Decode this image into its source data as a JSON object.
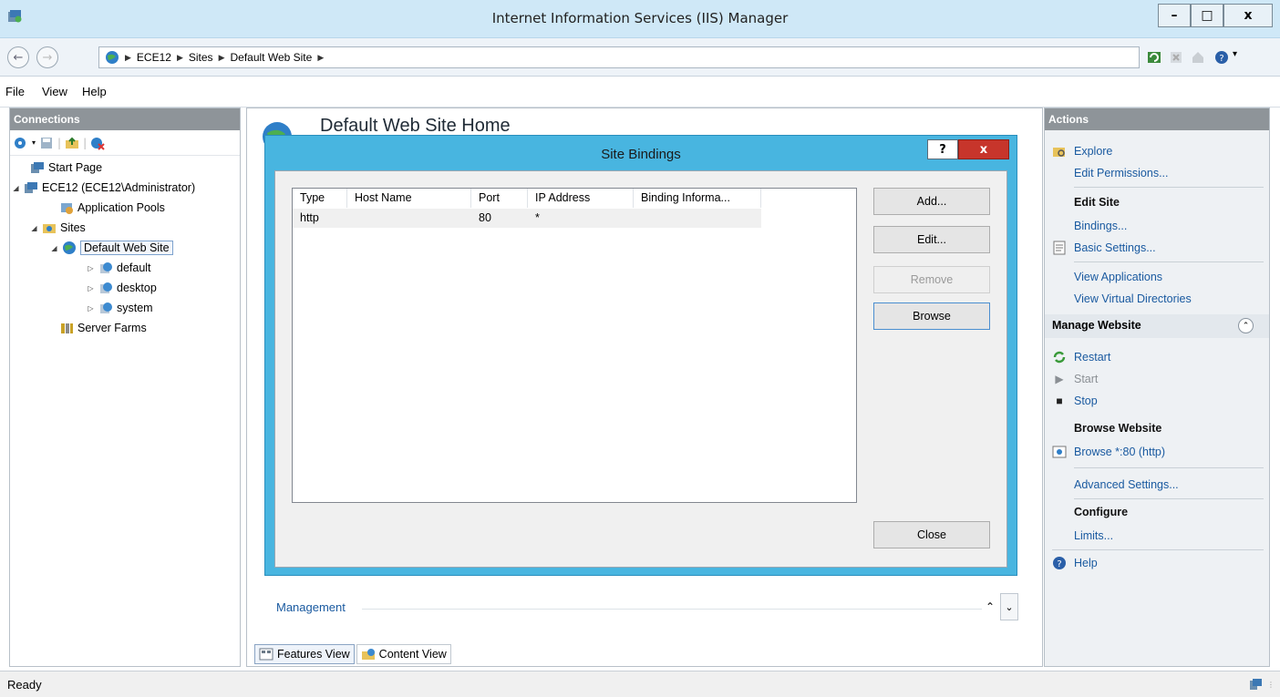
{
  "window": {
    "title": "Internet Information Services (IIS) Manager",
    "minimize": "–",
    "maximize": "□",
    "close": "x"
  },
  "address": {
    "crumbs": [
      "ECE12",
      "Sites",
      "Default Web Site"
    ]
  },
  "menu": {
    "file": "File",
    "view": "View",
    "help": "Help"
  },
  "connections": {
    "header": "Connections",
    "tree": {
      "start_page": "Start Page",
      "server": "ECE12 (ECE12\\Administrator)",
      "app_pools": "Application Pools",
      "sites": "Sites",
      "default_web_site": "Default Web Site",
      "child_default": "default",
      "child_desktop": "desktop",
      "child_system": "system",
      "server_farms": "Server Farms"
    }
  },
  "center": {
    "title": "Default Web Site Home",
    "management": "Management",
    "features_view": "Features View",
    "content_view": "Content View"
  },
  "dialog": {
    "title": "Site Bindings",
    "help": "?",
    "close_x": "x",
    "columns": [
      "Type",
      "Host Name",
      "Port",
      "IP Address",
      "Binding Informa..."
    ],
    "rows": [
      {
        "type": "http",
        "host": "",
        "port": "80",
        "ip": "*",
        "info": ""
      }
    ],
    "buttons": {
      "add": "Add...",
      "edit": "Edit...",
      "remove": "Remove",
      "browse": "Browse",
      "close": "Close"
    }
  },
  "actions": {
    "header": "Actions",
    "explore": "Explore",
    "edit_permissions": "Edit Permissions...",
    "edit_site": "Edit Site",
    "bindings": "Bindings...",
    "basic_settings": "Basic Settings...",
    "view_applications": "View Applications",
    "view_virtual_directories": "View Virtual Directories",
    "manage_website": "Manage Website",
    "restart": "Restart",
    "start": "Start",
    "stop": "Stop",
    "browse_website": "Browse Website",
    "browse_80": "Browse *:80 (http)",
    "advanced_settings": "Advanced Settings...",
    "configure": "Configure",
    "limits": "Limits...",
    "help": "Help"
  },
  "status": {
    "text": "Ready"
  },
  "colors": {
    "dialog_frame": "#48b5e0",
    "close_red": "#c7352b",
    "link_blue": "#1a5aa0",
    "panel_header": "#8e9499"
  }
}
